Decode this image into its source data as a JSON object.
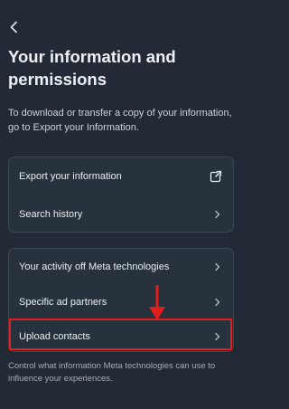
{
  "header": {
    "back_icon": "chevron-left-icon",
    "title": "Your information and permissions"
  },
  "description": "To download or transfer a copy of your information, go to Export your Information.",
  "section1": {
    "items": [
      {
        "label": "Export your information",
        "icon": "external-link-icon"
      },
      {
        "label": "Search history",
        "icon": "chevron-right-icon"
      }
    ]
  },
  "section2": {
    "items": [
      {
        "label": "Your activity off Meta technologies",
        "icon": "chevron-right-icon"
      },
      {
        "label": "Specific ad partners",
        "icon": "chevron-right-icon"
      },
      {
        "label": "Upload contacts",
        "icon": "chevron-right-icon",
        "highlighted": true
      }
    ]
  },
  "footer": "Control what information Meta technologies can use to influence your experiences.",
  "colors": {
    "background": "#222b35",
    "card": "#28323d",
    "highlight": "#e21d1d"
  }
}
